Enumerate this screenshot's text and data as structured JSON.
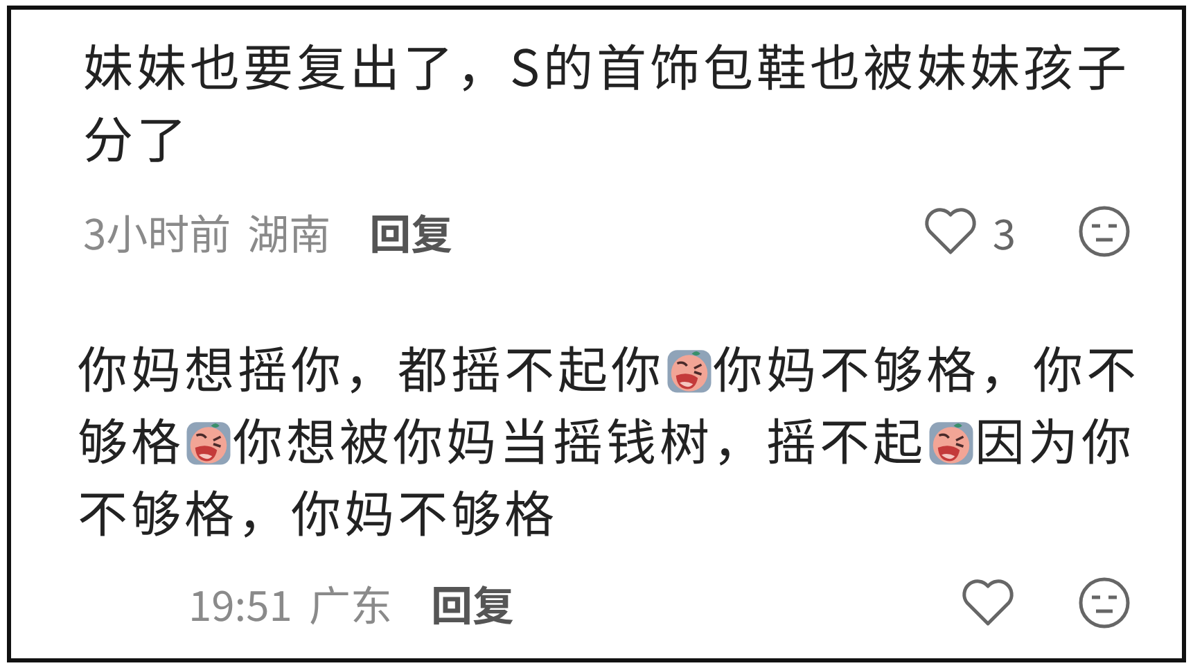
{
  "comments": [
    {
      "indent": false,
      "content": [
        {
          "kind": "text",
          "text": "妹妹也要复出了，S的首饰包鞋也被妹妹孩子分了"
        }
      ],
      "time": "3小时前",
      "location": "湖南",
      "reply": "回复",
      "likes": "3"
    },
    {
      "indent": true,
      "content": [
        {
          "kind": "text",
          "text": "你妈想摇你，都摇不起你"
        },
        {
          "kind": "sticker"
        },
        {
          "kind": "text",
          "text": "你妈不够格，你不够格"
        },
        {
          "kind": "sticker"
        },
        {
          "kind": "text",
          "text": "你想被你妈当摇钱树，摇不起"
        },
        {
          "kind": "sticker"
        },
        {
          "kind": "text",
          "text": "因为你不够格，你妈不够格"
        }
      ],
      "time": "19:51",
      "location": "广东",
      "reply": "回复"
    }
  ]
}
